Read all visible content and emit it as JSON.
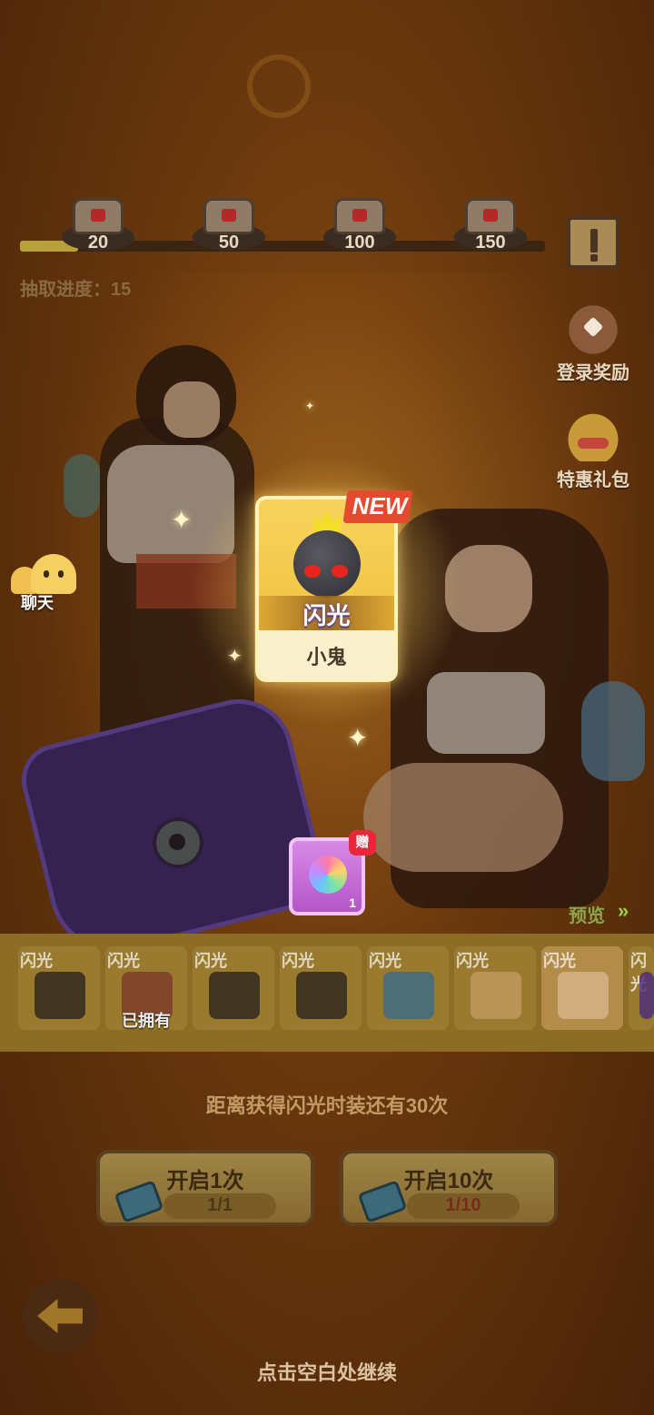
{
  "chest_rewards": {
    "progress_fraction": 0.11,
    "milestones": [
      {
        "count": "20"
      },
      {
        "count": "50"
      },
      {
        "count": "100"
      },
      {
        "count": "150"
      }
    ]
  },
  "draw_progress_text": "抽取进度：15",
  "side_buttons": {
    "login_reward": "登录奖励",
    "special_pack": "特惠礼包",
    "chat": "聊天"
  },
  "reward_card": {
    "badge": "NEW",
    "rarity": "闪光",
    "name": "小鬼",
    "icon": "ghost-bomb-icon"
  },
  "bonus_item": {
    "tag": "赠",
    "quantity": "1",
    "icon": "rainbow-gem-icon"
  },
  "preview_label": "预览",
  "item_strip": [
    {
      "tag": "闪光",
      "icon": "cloak-icon",
      "owned": ""
    },
    {
      "tag": "闪光",
      "icon": "figure-icon",
      "owned": "已拥有"
    },
    {
      "tag": "闪光",
      "icon": "glove-icon",
      "owned": ""
    },
    {
      "tag": "闪光",
      "icon": "boot-icon",
      "owned": ""
    },
    {
      "tag": "闪光",
      "icon": "lantern-icon",
      "owned": ""
    },
    {
      "tag": "闪光",
      "icon": "eyes-icon",
      "owned": ""
    },
    {
      "tag": "闪光",
      "icon": "scroll-icon",
      "owned": ""
    },
    {
      "tag": "闪光",
      "icon": "purple-icon",
      "owned": ""
    }
  ],
  "countdown_text": "距离获得闪光时装还有30次",
  "open_once": {
    "label": "开启1次",
    "count": "1/1"
  },
  "open_ten": {
    "label": "开启10次",
    "count": "1/10"
  },
  "continue_hint": "点击空白处继续",
  "colors": {
    "card_gold": "#f7d35c",
    "new_badge": "#e64a2e",
    "count_red": "#7a2a1a",
    "strip": "#8d6d26"
  }
}
